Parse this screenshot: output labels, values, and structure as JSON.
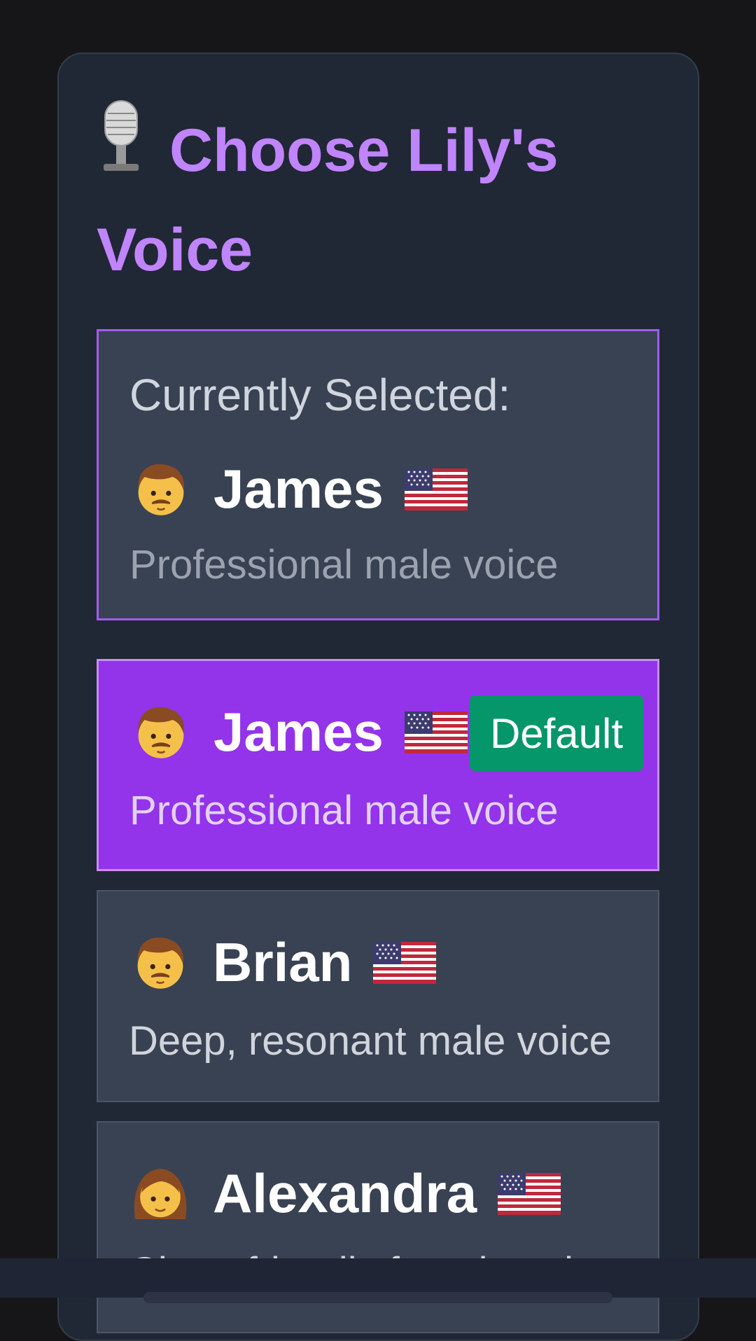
{
  "panel": {
    "title": "Choose Lily's Voice",
    "title_icon": "microphone-icon"
  },
  "current": {
    "label": "Currently Selected:",
    "voice": {
      "name": "James",
      "avatar": "man-icon",
      "flag": "us-flag-icon",
      "description": "Professional male voice"
    }
  },
  "voices": [
    {
      "name": "James",
      "avatar": "man-icon",
      "flag": "us-flag-icon",
      "description": "Professional male voice",
      "badge": "Default",
      "selected": true
    },
    {
      "name": "Brian",
      "avatar": "man-icon",
      "flag": "us-flag-icon",
      "description": "Deep, resonant male voice"
    },
    {
      "name": "Alexandra",
      "avatar": "woman-icon",
      "flag": "us-flag-icon",
      "description": "Clear, friendly female voice"
    }
  ],
  "colors": {
    "accent": "#c084fc",
    "selected_bg": "#9333ea",
    "badge_bg": "#059669",
    "panel_bg": "#202735",
    "card_bg": "#384253"
  }
}
